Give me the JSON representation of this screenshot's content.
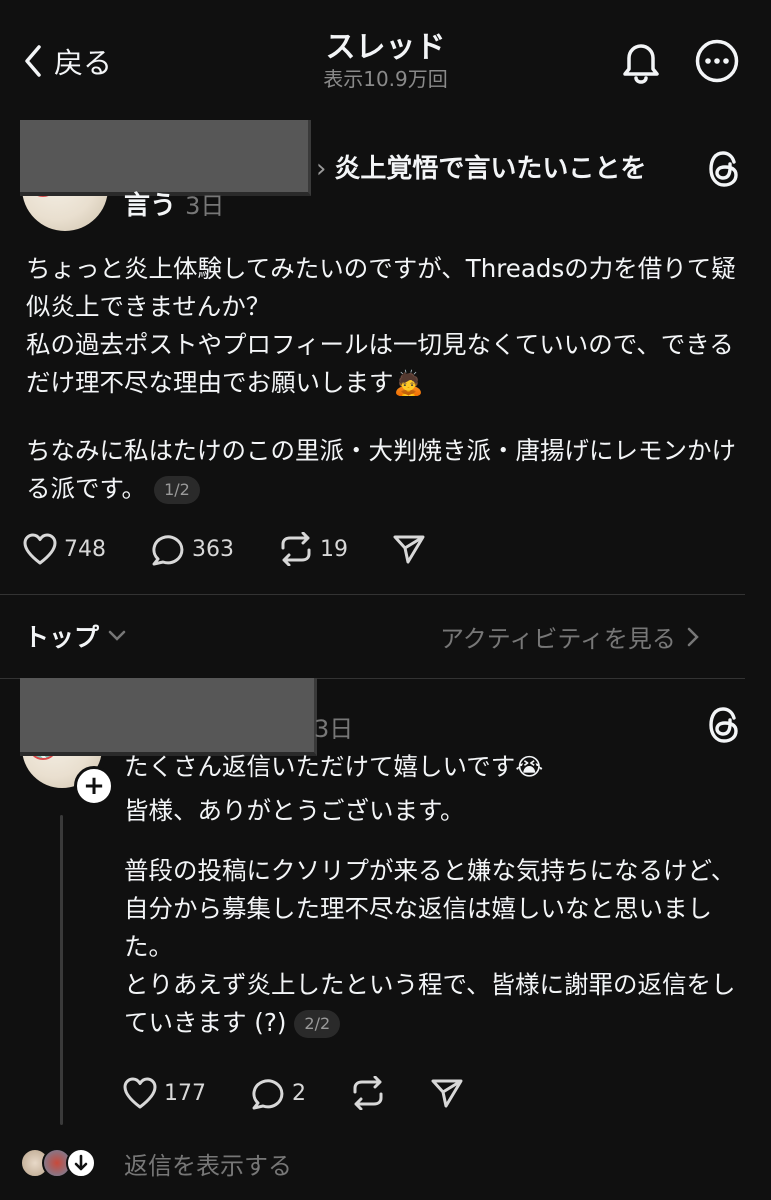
{
  "header": {
    "back_label": "戻る",
    "title": "スレッド",
    "views": "表示10.9万回"
  },
  "post": {
    "breadcrumb_line1": "炎上覚悟で言いたいことを",
    "breadcrumb_line2": "言う",
    "time": "3日",
    "paragraph1": "ちょっと炎上体験してみたいのですが、Threadsの力を借りて疑似炎上できませんか？\n私の過去ポストやプロフィールは一切見なくていいので、できるだけ理不尽な理由でお願いします",
    "emoji1": "🙇",
    "paragraph2": "ちなみに私はたけのこの里派・大判焼き派・唐揚げにレモンかける派です。",
    "page_badge": "1/2",
    "likes": "748",
    "comments": "363",
    "reposts": "19"
  },
  "sort": {
    "label": "トップ",
    "activity_label": "アクティビティを見る"
  },
  "reply": {
    "time": "3日",
    "line1": "たくさん返信いただけて嬉しいです",
    "emoji": "😭",
    "line2": "皆様、ありがとうございます。",
    "paragraph": "普段の投稿にクソリプが来ると嫌な気持ちになるけど、自分から募集した理不尽な返信は嬉しいなと思いました。\nとりあえず炎上したという程で、皆様に謝罪の返信をしていきます (?)",
    "page_badge": "2/2",
    "likes": "177",
    "comments": "2",
    "show_replies": "返信を表示する"
  }
}
